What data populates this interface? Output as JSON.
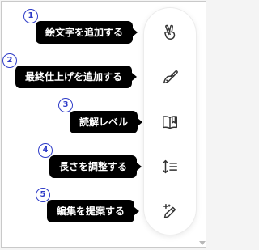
{
  "items": [
    {
      "number": "1",
      "tooltip": "絵文字を追加する",
      "icon": "peace-hand-icon"
    },
    {
      "number": "2",
      "tooltip": "最終仕上げを追加する",
      "icon": "paintbrush-icon"
    },
    {
      "number": "3",
      "tooltip": "読解レベル",
      "icon": "open-book-icon"
    },
    {
      "number": "4",
      "tooltip": "長さを調整する",
      "icon": "text-length-icon"
    },
    {
      "number": "5",
      "tooltip": "編集を提案する",
      "icon": "pencil-sparkle-icon"
    }
  ],
  "colors": {
    "tooltip_bg": "#000000",
    "tooltip_text": "#ffffff",
    "marker": "#2f3cc8",
    "icon": "#333333"
  }
}
